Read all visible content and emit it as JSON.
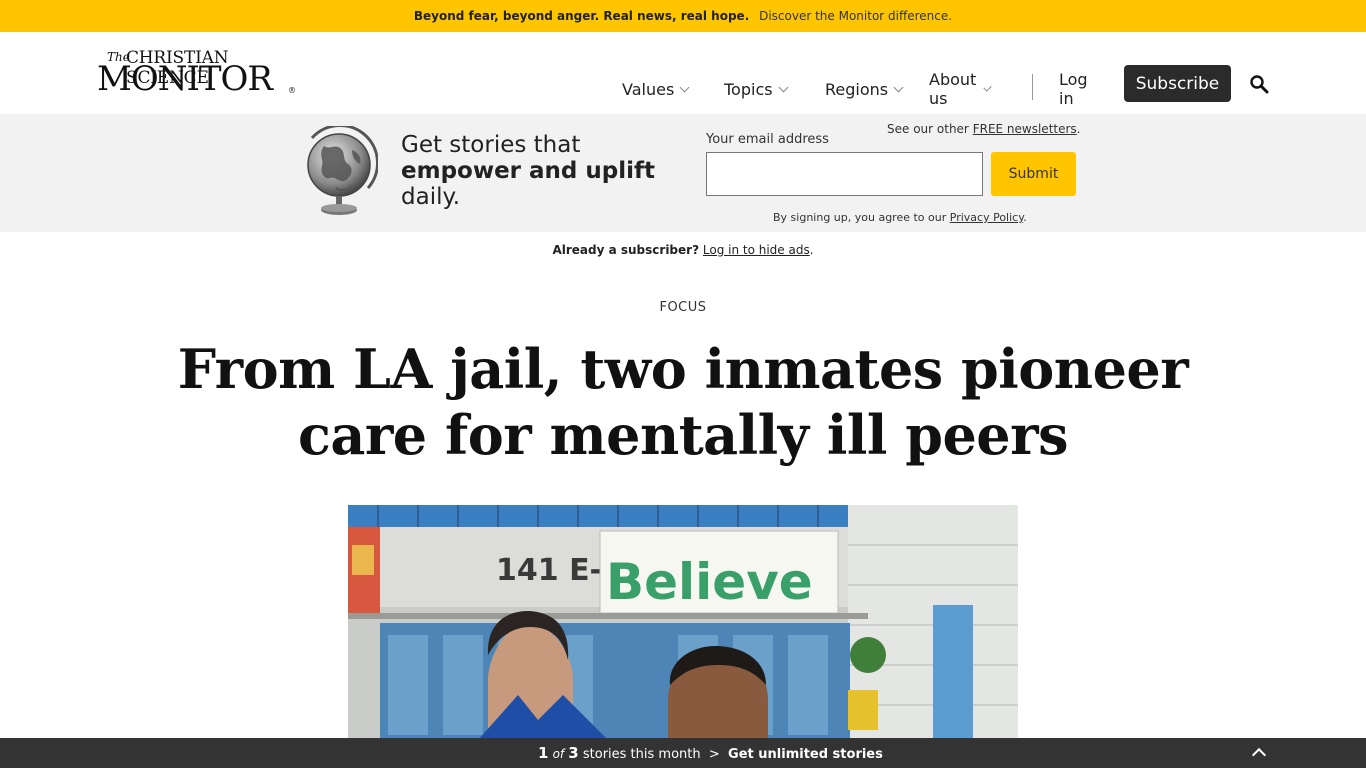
{
  "promo": {
    "strong": "Beyond fear, beyond anger. Real news, real hope.",
    "link": "Discover the Monitor difference."
  },
  "logo": {
    "the": "The",
    "line1": "CHRISTIAN SCIENCE",
    "line2": "MONITOR",
    "reg": "®"
  },
  "nav": {
    "values": "Values",
    "topics": "Topics",
    "regions": "Regions",
    "about": "About us",
    "login": "Log in",
    "subscribe": "Subscribe",
    "search_icon": "search-icon"
  },
  "newsletter": {
    "pitch_line1": "Get stories that",
    "pitch_line2": "empower and uplift",
    "pitch_line3": "daily.",
    "email_label": "Your email address",
    "other_prefix": "See our other",
    "other_link": "FREE newsletters",
    "other_suffix": ".",
    "email_value": "",
    "email_placeholder": "",
    "submit": "Submit",
    "terms_prefix": "By signing up, you agree to our",
    "terms_link": "Privacy Policy",
    "terms_suffix": "."
  },
  "subscriber": {
    "prefix": "Already a subscriber?",
    "link": "Log in to hide ads",
    "suffix": "."
  },
  "article": {
    "kicker": "FOCUS",
    "headline": "From LA jail, two inmates pioneer care for mentally ill peers"
  },
  "photo": {
    "sign_text": "141 E-P",
    "banner_text": "Believe"
  },
  "meter": {
    "count": "1",
    "of": "of",
    "total": "3",
    "label": "stories this month",
    "sep": ">",
    "cta": "Get unlimited stories"
  },
  "colors": {
    "accent": "#ffc600",
    "dark": "#2b2b2b",
    "band": "#f2f2f2"
  }
}
